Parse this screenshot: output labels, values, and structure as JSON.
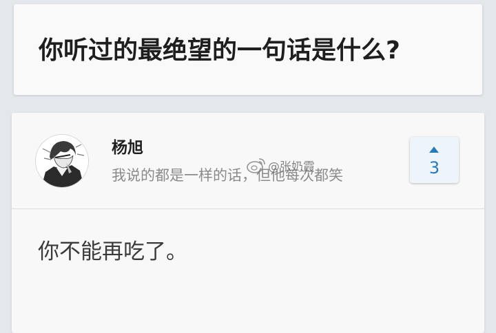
{
  "question": {
    "title": "你听过的最绝望的一句话是什么?"
  },
  "answer": {
    "author": {
      "name": "杨旭",
      "bio": "我说的都是一样的话，但他每次都笑"
    },
    "vote": {
      "count": "3"
    },
    "content": "你不能再吃了。"
  },
  "watermark": {
    "text": "@张奶霞"
  },
  "colors": {
    "background": "#e4e7eb",
    "card": "#f9f9f9",
    "accent": "#2a7ab8",
    "vote_bg": "#eef5fa"
  }
}
